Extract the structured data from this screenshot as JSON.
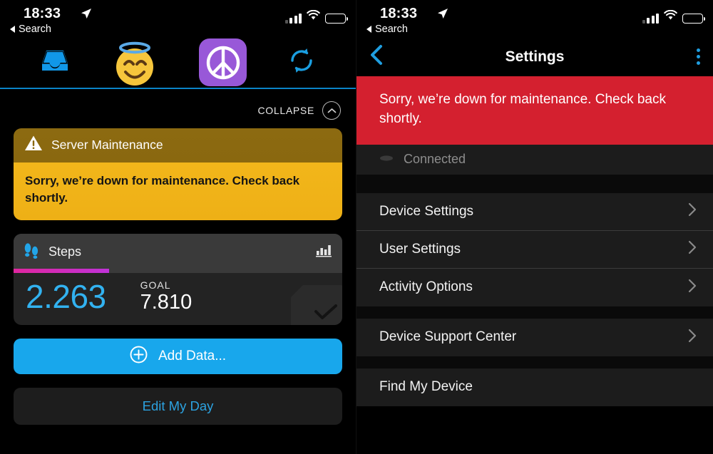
{
  "status_bar": {
    "time": "18:33",
    "back_label": "Search",
    "location_icon": "location-arrow-icon",
    "signal_icon": "cellular-signal-icon",
    "wifi_icon": "wifi-icon",
    "battery_icon": "battery-icon"
  },
  "left_pane": {
    "tabs": [
      {
        "name": "inbox-tab",
        "icon": "inbox-icon"
      },
      {
        "name": "smiling-face-halo-tab",
        "icon": "smiling-face-with-halo-emoji"
      },
      {
        "name": "peace-tab",
        "icon": "peace-symbol-icon"
      },
      {
        "name": "sync-tab",
        "icon": "sync-refresh-icon"
      }
    ],
    "collapse": {
      "label": "COLLAPSE",
      "icon": "chevron-up-icon"
    },
    "alert": {
      "icon": "warning-triangle-icon",
      "title": "Server Maintenance",
      "message": "Sorry, we’re down for maintenance. Check back shortly."
    },
    "steps_card": {
      "icon": "footprints-icon",
      "title": "Steps",
      "chart_icon": "bar-chart-icon",
      "value": "2.263",
      "goal_label": "GOAL",
      "goal_value": "7.810",
      "progress_percent": 29,
      "corner_icon": "checkmark-icon"
    },
    "add_data_button": {
      "label": "Add Data...",
      "icon": "plus-circle-icon"
    },
    "edit_day_button": {
      "label": "Edit My Day"
    }
  },
  "right_pane": {
    "nav": {
      "back_icon": "chevron-left-icon",
      "title": "Settings",
      "menu_icon": "overflow-menu-icon"
    },
    "banner": {
      "message": "Sorry, we’re down for maintenance. Check back shortly."
    },
    "obscured_row": {
      "label": "Connected",
      "icon": "device-icon"
    },
    "groups": [
      {
        "items": [
          {
            "label": "Device Settings",
            "chevron": true
          },
          {
            "label": "User Settings",
            "chevron": true
          },
          {
            "label": "Activity Options",
            "chevron": true
          }
        ]
      },
      {
        "items": [
          {
            "label": "Device Support Center",
            "chevron": true
          }
        ]
      },
      {
        "items": [
          {
            "label": "Find My Device",
            "chevron": false
          }
        ]
      }
    ]
  },
  "colors": {
    "accent_blue": "#18a7ec",
    "alert_amber": "#f2b61a",
    "alert_amber_dark": "#8c6a11",
    "banner_red": "#d4202f",
    "progress_magenta": "#e0269f",
    "peace_purple": "#9858d8"
  }
}
